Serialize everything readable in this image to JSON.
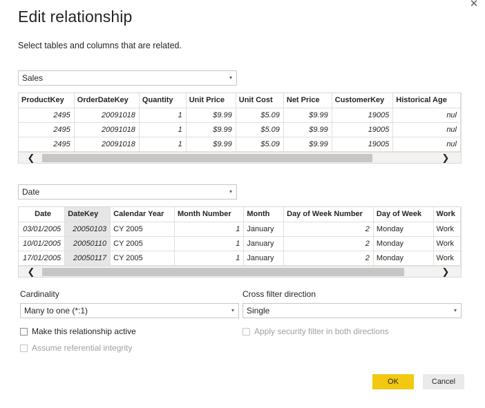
{
  "dialog": {
    "title": "Edit relationship",
    "subtitle": "Select tables and columns that are related.",
    "close_glyph": "✕"
  },
  "table1": {
    "selected": "Sales",
    "columns": [
      "ProductKey",
      "OrderDateKey",
      "Quantity",
      "Unit Price",
      "Unit Cost",
      "Net Price",
      "CustomerKey",
      "Historical Age"
    ],
    "rows": [
      [
        "2495",
        "20091018",
        "1",
        "$9.99",
        "$5.09",
        "$9.99",
        "19005",
        "nul"
      ],
      [
        "2495",
        "20091018",
        "1",
        "$9.99",
        "$5.09",
        "$9.99",
        "19005",
        "nul"
      ],
      [
        "2495",
        "20091018",
        "1",
        "$9.99",
        "$5.09",
        "$9.99",
        "19005",
        "nul"
      ]
    ]
  },
  "table2": {
    "selected": "Date",
    "columns": [
      "Date",
      "DateKey",
      "Calendar Year",
      "Month Number",
      "Month",
      "Day of Week Number",
      "Day of Week",
      "Work"
    ],
    "rows": [
      [
        "03/01/2005",
        "20050103",
        "CY 2005",
        "1",
        "January",
        "2",
        "Monday",
        "Work"
      ],
      [
        "10/01/2005",
        "20050110",
        "CY 2005",
        "1",
        "January",
        "2",
        "Monday",
        "Work"
      ],
      [
        "17/01/2005",
        "20050117",
        "CY 2005",
        "1",
        "January",
        "2",
        "Monday",
        "Work"
      ]
    ]
  },
  "cardinality": {
    "label": "Cardinality",
    "value": "Many to one (*:1)"
  },
  "cross_filter": {
    "label": "Cross filter direction",
    "value": "Single"
  },
  "options": {
    "make_active": "Make this relationship active",
    "referential_integrity": "Assume referential integrity",
    "security_filter": "Apply security filter in both directions"
  },
  "buttons": {
    "ok": "OK",
    "cancel": "Cancel"
  },
  "icons": {
    "caret": "▾",
    "scroll_left": "❮",
    "scroll_right": "❯"
  },
  "colors": {
    "accent": "#f2c811",
    "selected_column": "#e6e6e6"
  }
}
